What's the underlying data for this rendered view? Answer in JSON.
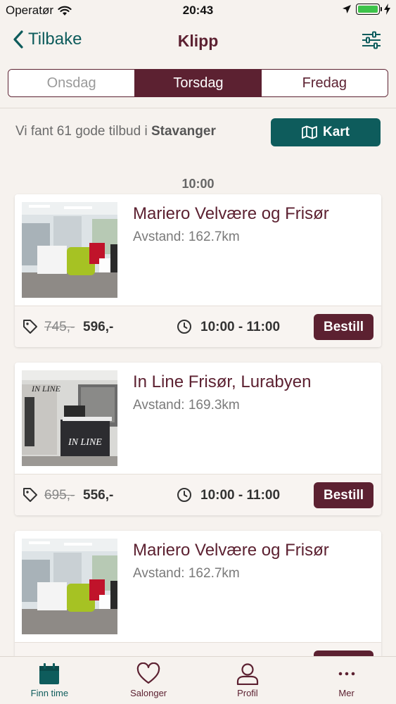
{
  "status_bar": {
    "carrier": "Operatør",
    "time": "20:43"
  },
  "nav": {
    "back_label": "Tilbake",
    "title": "Klipp"
  },
  "days": [
    {
      "label": "Onsdag",
      "state": "disabled"
    },
    {
      "label": "Torsdag",
      "state": "active"
    },
    {
      "label": "Fredag",
      "state": "normal"
    }
  ],
  "summary": {
    "prefix": "Vi fant 61 gode tilbud i ",
    "city": "Stavanger"
  },
  "map_button": {
    "label": "Kart"
  },
  "time_group": "10:00",
  "offers": [
    {
      "name": "Mariero Velvære og Frisør",
      "distance": "Avstand: 162.7km",
      "old_price": "745,-",
      "new_price": "596,-",
      "slot": "10:00 - 11:00",
      "book_label": "Bestill"
    },
    {
      "name": "In Line Frisør, Lurabyen",
      "distance": "Avstand: 169.3km",
      "old_price": "695,-",
      "new_price": "556,-",
      "slot": "10:00 - 11:00",
      "book_label": "Bestill"
    },
    {
      "name": "Mariero Velvære og Frisør",
      "distance": "Avstand: 162.7km",
      "old_price": "",
      "new_price": "",
      "slot": "",
      "book_label": ""
    }
  ],
  "salon_sign": "IN LINE",
  "tabbar": [
    {
      "label": "Finn time",
      "icon": "calendar-icon",
      "active": true
    },
    {
      "label": "Salonger",
      "icon": "heart-icon",
      "active": false
    },
    {
      "label": "Profil",
      "icon": "person-icon",
      "active": false
    },
    {
      "label": "Mer",
      "icon": "more-icon",
      "active": false
    }
  ],
  "colors": {
    "accent": "#5c2131",
    "teal": "#0e5c5c",
    "background": "#f6f2ee"
  }
}
